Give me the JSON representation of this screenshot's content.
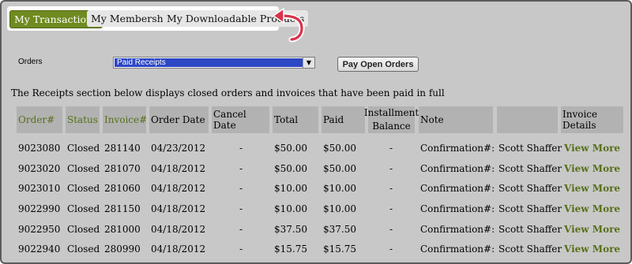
{
  "tabs": [
    {
      "label": "My Transactions",
      "active": true
    },
    {
      "label": "My Memberships",
      "active": false
    },
    {
      "label": "My Downloadable Products",
      "active": false
    }
  ],
  "filter": {
    "label": "Orders",
    "selected": "Paid Receipts",
    "dropdown_icon": "triangle-down-icon"
  },
  "pay_button": "Pay Open Orders",
  "description": "The Receipts section below displays closed orders and invoices that have been paid in full",
  "table": {
    "headers": {
      "order": "Order#",
      "status": "Status",
      "invoice": "Invoice#",
      "order_date": "Order Date",
      "cancel_date": "Cancel Date",
      "total": "Total",
      "paid": "Paid",
      "installment_1": "Installment",
      "installment_2": "Balance",
      "note": "Note",
      "blank": "",
      "invoice_details": "Invoice Details"
    },
    "rows": [
      {
        "order": "9023080",
        "status": "Closed",
        "invoice": "281140",
        "order_date": "04/23/2012",
        "cancel_date": "-",
        "total": "$50.00",
        "paid": "$50.00",
        "installment": "-",
        "note": "Confirmation#:",
        "name": "Scott Shaffer",
        "link": "View More"
      },
      {
        "order": "9023020",
        "status": "Closed",
        "invoice": "281070",
        "order_date": "04/18/2012",
        "cancel_date": "-",
        "total": "$50.00",
        "paid": "$50.00",
        "installment": "-",
        "note": "Confirmation#:",
        "name": "Scott Shaffer",
        "link": "View More"
      },
      {
        "order": "9023010",
        "status": "Closed",
        "invoice": "281060",
        "order_date": "04/18/2012",
        "cancel_date": "-",
        "total": "$10.00",
        "paid": "$10.00",
        "installment": "-",
        "note": "Confirmation#:",
        "name": "Scott Shaffer",
        "link": "View More"
      },
      {
        "order": "9022990",
        "status": "Closed",
        "invoice": "281150",
        "order_date": "04/18/2012",
        "cancel_date": "-",
        "total": "$10.00",
        "paid": "$10.00",
        "installment": "-",
        "note": "Confirmation#:",
        "name": "Scott Shaffer",
        "link": "View More"
      },
      {
        "order": "9022950",
        "status": "Closed",
        "invoice": "281000",
        "order_date": "04/18/2012",
        "cancel_date": "-",
        "total": "$37.50",
        "paid": "$37.50",
        "installment": "-",
        "note": "Confirmation#:",
        "name": "Scott Shaffer",
        "link": "View More"
      },
      {
        "order": "9022940",
        "status": "Closed",
        "invoice": "280990",
        "order_date": "04/18/2012",
        "cancel_date": "-",
        "total": "$15.75",
        "paid": "$15.75",
        "installment": "-",
        "note": "Confirmation#:",
        "name": "Scott Shaffer",
        "link": "View More"
      }
    ]
  },
  "annotation_icon": "curved-arrow-icon",
  "colors": {
    "accent": "#6f8a1f",
    "link": "#57701a",
    "background": "#c8c8c8",
    "header_cell": "#b2b2b2",
    "select_highlight": "#2d47c5",
    "annotation": "#d9334a"
  }
}
